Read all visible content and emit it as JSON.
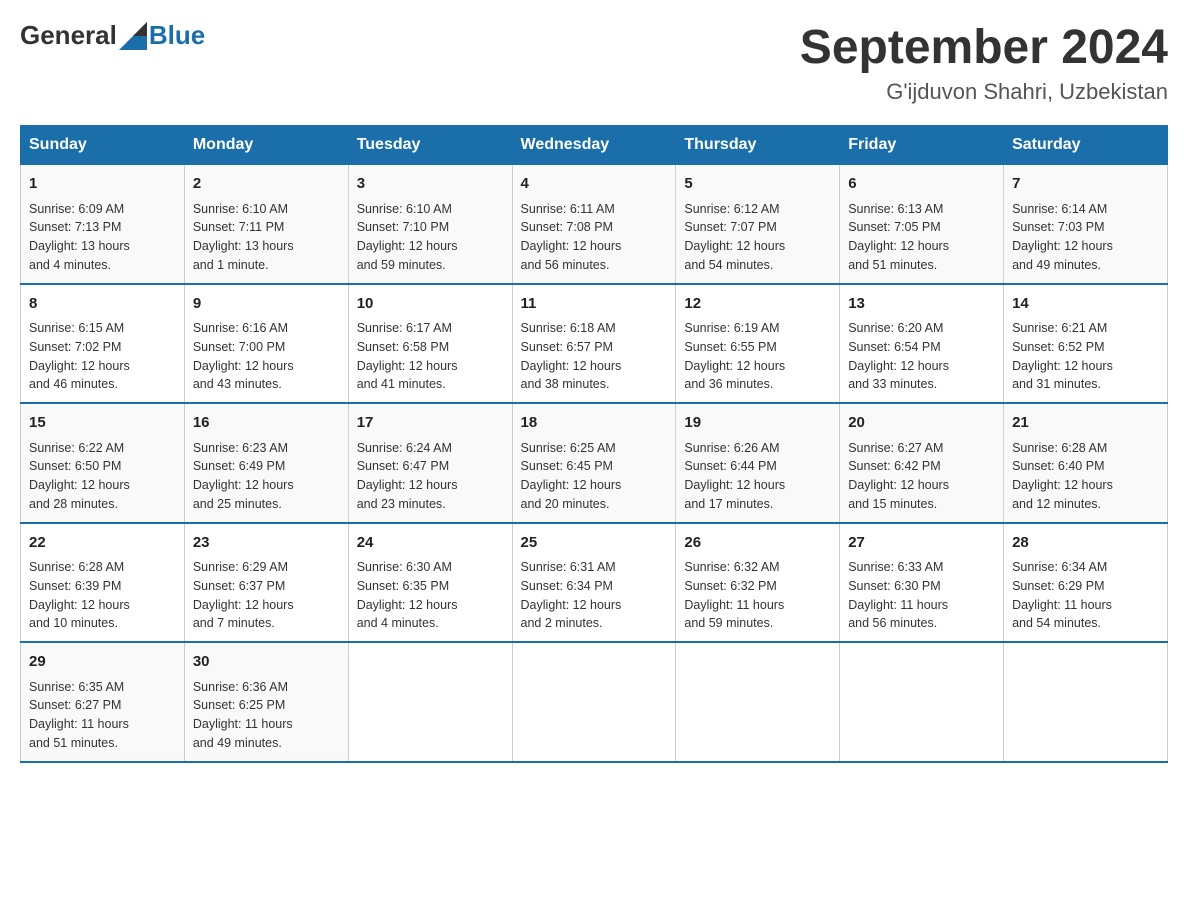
{
  "header": {
    "logo_general": "General",
    "logo_blue": "Blue",
    "title": "September 2024",
    "subtitle": "G'ijduvon Shahri, Uzbekistan"
  },
  "columns": [
    "Sunday",
    "Monday",
    "Tuesday",
    "Wednesday",
    "Thursday",
    "Friday",
    "Saturday"
  ],
  "weeks": [
    [
      {
        "day": "1",
        "info": "Sunrise: 6:09 AM\nSunset: 7:13 PM\nDaylight: 13 hours\nand 4 minutes."
      },
      {
        "day": "2",
        "info": "Sunrise: 6:10 AM\nSunset: 7:11 PM\nDaylight: 13 hours\nand 1 minute."
      },
      {
        "day": "3",
        "info": "Sunrise: 6:10 AM\nSunset: 7:10 PM\nDaylight: 12 hours\nand 59 minutes."
      },
      {
        "day": "4",
        "info": "Sunrise: 6:11 AM\nSunset: 7:08 PM\nDaylight: 12 hours\nand 56 minutes."
      },
      {
        "day": "5",
        "info": "Sunrise: 6:12 AM\nSunset: 7:07 PM\nDaylight: 12 hours\nand 54 minutes."
      },
      {
        "day": "6",
        "info": "Sunrise: 6:13 AM\nSunset: 7:05 PM\nDaylight: 12 hours\nand 51 minutes."
      },
      {
        "day": "7",
        "info": "Sunrise: 6:14 AM\nSunset: 7:03 PM\nDaylight: 12 hours\nand 49 minutes."
      }
    ],
    [
      {
        "day": "8",
        "info": "Sunrise: 6:15 AM\nSunset: 7:02 PM\nDaylight: 12 hours\nand 46 minutes."
      },
      {
        "day": "9",
        "info": "Sunrise: 6:16 AM\nSunset: 7:00 PM\nDaylight: 12 hours\nand 43 minutes."
      },
      {
        "day": "10",
        "info": "Sunrise: 6:17 AM\nSunset: 6:58 PM\nDaylight: 12 hours\nand 41 minutes."
      },
      {
        "day": "11",
        "info": "Sunrise: 6:18 AM\nSunset: 6:57 PM\nDaylight: 12 hours\nand 38 minutes."
      },
      {
        "day": "12",
        "info": "Sunrise: 6:19 AM\nSunset: 6:55 PM\nDaylight: 12 hours\nand 36 minutes."
      },
      {
        "day": "13",
        "info": "Sunrise: 6:20 AM\nSunset: 6:54 PM\nDaylight: 12 hours\nand 33 minutes."
      },
      {
        "day": "14",
        "info": "Sunrise: 6:21 AM\nSunset: 6:52 PM\nDaylight: 12 hours\nand 31 minutes."
      }
    ],
    [
      {
        "day": "15",
        "info": "Sunrise: 6:22 AM\nSunset: 6:50 PM\nDaylight: 12 hours\nand 28 minutes."
      },
      {
        "day": "16",
        "info": "Sunrise: 6:23 AM\nSunset: 6:49 PM\nDaylight: 12 hours\nand 25 minutes."
      },
      {
        "day": "17",
        "info": "Sunrise: 6:24 AM\nSunset: 6:47 PM\nDaylight: 12 hours\nand 23 minutes."
      },
      {
        "day": "18",
        "info": "Sunrise: 6:25 AM\nSunset: 6:45 PM\nDaylight: 12 hours\nand 20 minutes."
      },
      {
        "day": "19",
        "info": "Sunrise: 6:26 AM\nSunset: 6:44 PM\nDaylight: 12 hours\nand 17 minutes."
      },
      {
        "day": "20",
        "info": "Sunrise: 6:27 AM\nSunset: 6:42 PM\nDaylight: 12 hours\nand 15 minutes."
      },
      {
        "day": "21",
        "info": "Sunrise: 6:28 AM\nSunset: 6:40 PM\nDaylight: 12 hours\nand 12 minutes."
      }
    ],
    [
      {
        "day": "22",
        "info": "Sunrise: 6:28 AM\nSunset: 6:39 PM\nDaylight: 12 hours\nand 10 minutes."
      },
      {
        "day": "23",
        "info": "Sunrise: 6:29 AM\nSunset: 6:37 PM\nDaylight: 12 hours\nand 7 minutes."
      },
      {
        "day": "24",
        "info": "Sunrise: 6:30 AM\nSunset: 6:35 PM\nDaylight: 12 hours\nand 4 minutes."
      },
      {
        "day": "25",
        "info": "Sunrise: 6:31 AM\nSunset: 6:34 PM\nDaylight: 12 hours\nand 2 minutes."
      },
      {
        "day": "26",
        "info": "Sunrise: 6:32 AM\nSunset: 6:32 PM\nDaylight: 11 hours\nand 59 minutes."
      },
      {
        "day": "27",
        "info": "Sunrise: 6:33 AM\nSunset: 6:30 PM\nDaylight: 11 hours\nand 56 minutes."
      },
      {
        "day": "28",
        "info": "Sunrise: 6:34 AM\nSunset: 6:29 PM\nDaylight: 11 hours\nand 54 minutes."
      }
    ],
    [
      {
        "day": "29",
        "info": "Sunrise: 6:35 AM\nSunset: 6:27 PM\nDaylight: 11 hours\nand 51 minutes."
      },
      {
        "day": "30",
        "info": "Sunrise: 6:36 AM\nSunset: 6:25 PM\nDaylight: 11 hours\nand 49 minutes."
      },
      {
        "day": "",
        "info": ""
      },
      {
        "day": "",
        "info": ""
      },
      {
        "day": "",
        "info": ""
      },
      {
        "day": "",
        "info": ""
      },
      {
        "day": "",
        "info": ""
      }
    ]
  ]
}
